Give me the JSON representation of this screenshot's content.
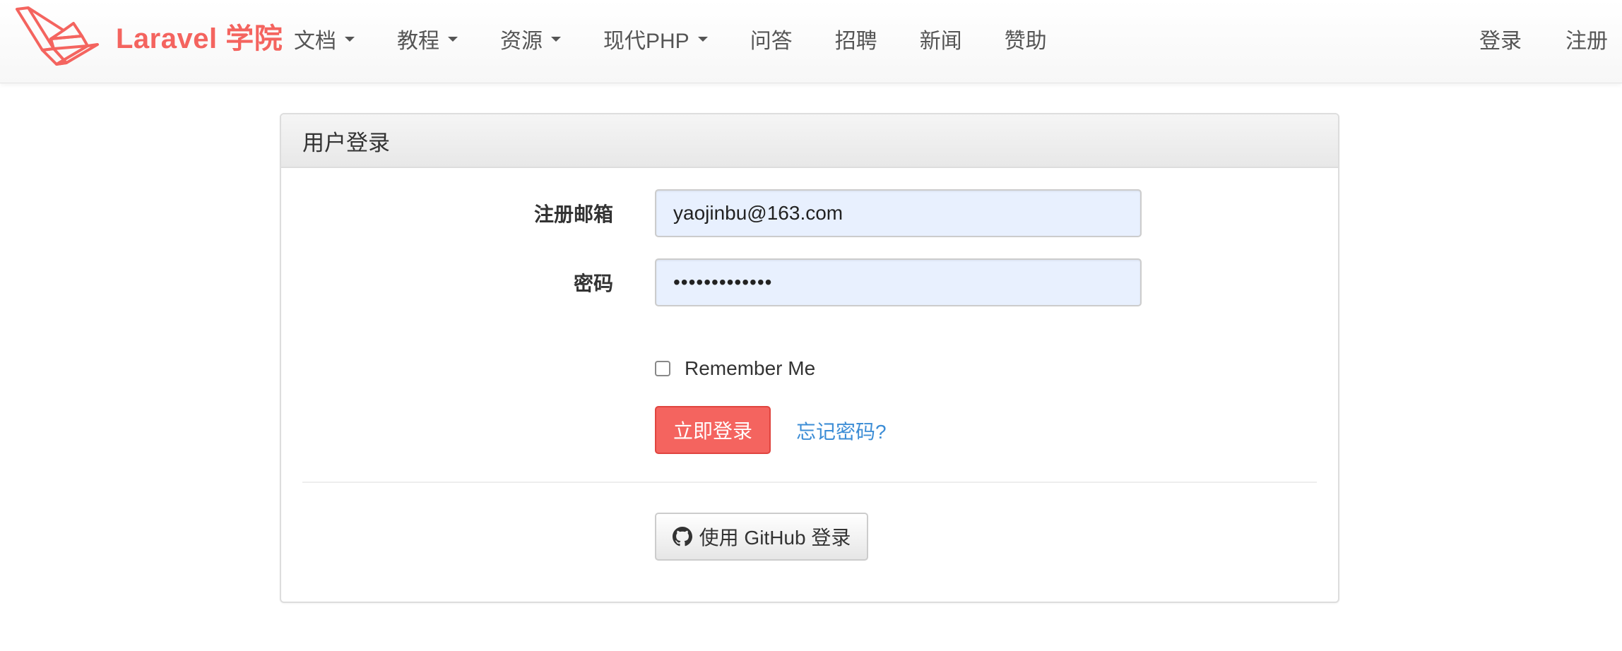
{
  "navbar": {
    "brand_text": "Laravel 学院",
    "brand_icon": "laravel-logo",
    "brand_color": "#f4645f",
    "left_items": [
      {
        "label": "文档",
        "dropdown": true
      },
      {
        "label": "教程",
        "dropdown": true
      },
      {
        "label": "资源",
        "dropdown": true
      },
      {
        "label": "现代PHP",
        "dropdown": true
      },
      {
        "label": "问答",
        "dropdown": false
      },
      {
        "label": "招聘",
        "dropdown": false
      },
      {
        "label": "新闻",
        "dropdown": false
      },
      {
        "label": "赞助",
        "dropdown": false
      }
    ],
    "right_items": [
      {
        "label": "登录"
      },
      {
        "label": "注册"
      }
    ]
  },
  "login_panel": {
    "title": "用户登录",
    "email_label": "注册邮箱",
    "email_value": "yaojinbu@163.com",
    "password_label": "密码",
    "password_value": "•••••••••••••",
    "remember_label": "Remember Me",
    "remember_checked": false,
    "submit_label": "立即登录",
    "submit_color": "#f4645f",
    "forgot_label": "忘记密码?",
    "link_color": "#3c8dd6",
    "github_label": "使用 GitHub 登录",
    "github_icon": "github-icon"
  }
}
